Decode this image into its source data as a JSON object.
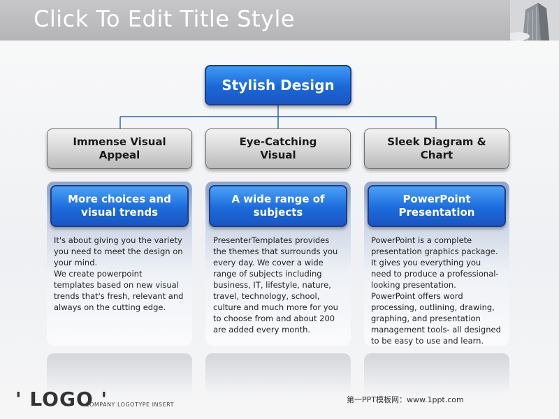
{
  "slide": {
    "title": "Click To Edit Title Style",
    "root_label": "Stylish Design",
    "columns": [
      {
        "heading": "Immense Visual\nAppeal",
        "subheading": "More choices and\nvisual trends",
        "description": "It's about giving you the variety\nyou need to meet the design on\nyour mind.\nWe create powerpoint\ntemplates based on new visual\ntrends that's fresh, relevant and\nalways on the cutting edge."
      },
      {
        "heading": "Eye-Catching\nVisual",
        "subheading": "A wide range of\nsubjects",
        "description": "PresenterTemplates provides\nthe themes that surrounds you\nevery day. We cover a wide\nrange of subjects including\nbusiness, IT, lifestyle, nature,\ntravel, technology, school,\nculture and much more for you\nto choose from and about 200\nare added every month."
      },
      {
        "heading": "Sleek Diagram &\nChart",
        "subheading": "PowerPoint\nPresentation",
        "description": "PowerPoint is a complete\npresentation graphics package.\nIt gives you everything you\nneed to produce a professional-\nlooking presentation.\nPowerPoint offers word\nprocessing, outlining, drawing,\ngraphing, and presentation\nmanagement tools- all designed\nto be easy to use and learn."
      }
    ],
    "logo": "' LOGO '",
    "logo_tagline": "COMPANY LOGOTYPE INSERT",
    "footer_note": "第一PPT模板网：www.1ppt.com"
  },
  "colors": {
    "title_bar": "#b9b9bc",
    "accent_blue": "#1a67d8",
    "connector": "#2f63b8",
    "grey_box": "#c8c8c8"
  }
}
